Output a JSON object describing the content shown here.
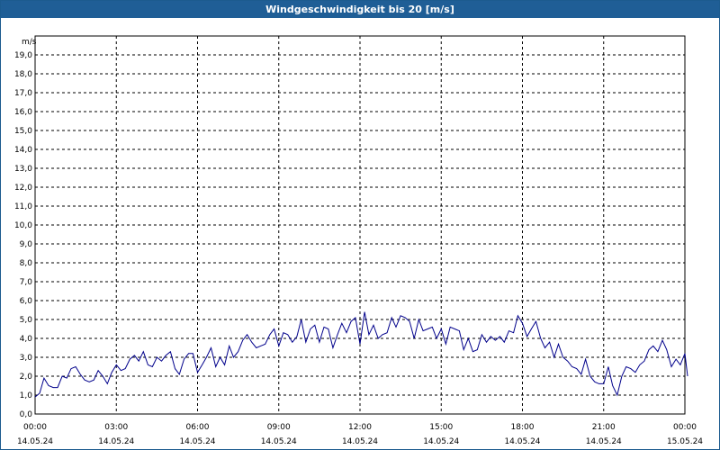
{
  "window": {
    "title": "Windgeschwindigkeit bis 20 [m/s]"
  },
  "chart_data": {
    "type": "line",
    "title": "Windgeschwindigkeit bis 20 [m/s]",
    "ylabel": "m/s",
    "xlabel": "",
    "ylim": [
      0,
      20
    ],
    "xlim": [
      0,
      24
    ],
    "grid": true,
    "line_color": "#00008b",
    "y_ticks": [
      "0,0",
      "1,0",
      "2,0",
      "3,0",
      "4,0",
      "5,0",
      "6,0",
      "7,0",
      "8,0",
      "9,0",
      "10,0",
      "11,0",
      "12,0",
      "13,0",
      "14,0",
      "15,0",
      "16,0",
      "17,0",
      "18,0",
      "19,0"
    ],
    "x_ticks": [
      {
        "time": "00:00",
        "date": "14.05.24"
      },
      {
        "time": "03:00",
        "date": "14.05.24"
      },
      {
        "time": "06:00",
        "date": "14.05.24"
      },
      {
        "time": "09:00",
        "date": "14.05.24"
      },
      {
        "time": "12:00",
        "date": "14.05.24"
      },
      {
        "time": "15:00",
        "date": "14.05.24"
      },
      {
        "time": "18:00",
        "date": "14.05.24"
      },
      {
        "time": "21:00",
        "date": "14.05.24"
      },
      {
        "time": "00:00",
        "date": "15.05.24"
      }
    ],
    "series": [
      {
        "values": [
          [
            0.0,
            0.9
          ],
          [
            0.17,
            1.1
          ],
          [
            0.33,
            1.9
          ],
          [
            0.5,
            1.5
          ],
          [
            0.67,
            1.4
          ],
          [
            0.83,
            1.4
          ],
          [
            1.0,
            2.0
          ],
          [
            1.17,
            1.9
          ],
          [
            1.33,
            2.4
          ],
          [
            1.5,
            2.5
          ],
          [
            1.67,
            2.1
          ],
          [
            1.83,
            1.8
          ],
          [
            2.0,
            1.7
          ],
          [
            2.17,
            1.8
          ],
          [
            2.33,
            2.3
          ],
          [
            2.5,
            2.0
          ],
          [
            2.67,
            1.6
          ],
          [
            2.83,
            2.2
          ],
          [
            3.0,
            2.6
          ],
          [
            3.17,
            2.3
          ],
          [
            3.33,
            2.4
          ],
          [
            3.5,
            2.9
          ],
          [
            3.67,
            3.1
          ],
          [
            3.83,
            2.8
          ],
          [
            4.0,
            3.3
          ],
          [
            4.17,
            2.6
          ],
          [
            4.33,
            2.5
          ],
          [
            4.5,
            3.0
          ],
          [
            4.67,
            2.8
          ],
          [
            4.83,
            3.1
          ],
          [
            5.0,
            3.3
          ],
          [
            5.17,
            2.4
          ],
          [
            5.33,
            2.1
          ],
          [
            5.5,
            2.9
          ],
          [
            5.67,
            3.2
          ],
          [
            5.83,
            3.2
          ],
          [
            6.0,
            2.2
          ],
          [
            6.17,
            2.6
          ],
          [
            6.33,
            3.0
          ],
          [
            6.5,
            3.5
          ],
          [
            6.67,
            2.5
          ],
          [
            6.83,
            3.0
          ],
          [
            7.0,
            2.6
          ],
          [
            7.17,
            3.6
          ],
          [
            7.33,
            3.0
          ],
          [
            7.5,
            3.3
          ],
          [
            7.67,
            3.9
          ],
          [
            7.83,
            4.2
          ],
          [
            8.0,
            3.8
          ],
          [
            8.17,
            3.5
          ],
          [
            8.33,
            3.6
          ],
          [
            8.5,
            3.7
          ],
          [
            8.67,
            4.2
          ],
          [
            8.83,
            4.5
          ],
          [
            9.0,
            3.6
          ],
          [
            9.17,
            4.3
          ],
          [
            9.33,
            4.2
          ],
          [
            9.5,
            3.8
          ],
          [
            9.67,
            4.1
          ],
          [
            9.83,
            5.0
          ],
          [
            10.0,
            3.8
          ],
          [
            10.17,
            4.5
          ],
          [
            10.33,
            4.7
          ],
          [
            10.5,
            3.8
          ],
          [
            10.67,
            4.6
          ],
          [
            10.83,
            4.5
          ],
          [
            11.0,
            3.5
          ],
          [
            11.17,
            4.2
          ],
          [
            11.33,
            4.8
          ],
          [
            11.5,
            4.3
          ],
          [
            11.67,
            4.9
          ],
          [
            11.83,
            5.1
          ],
          [
            12.0,
            3.7
          ],
          [
            12.17,
            5.4
          ],
          [
            12.33,
            4.2
          ],
          [
            12.5,
            4.7
          ],
          [
            12.67,
            4.0
          ],
          [
            12.83,
            4.2
          ],
          [
            13.0,
            4.3
          ],
          [
            13.17,
            5.1
          ],
          [
            13.33,
            4.6
          ],
          [
            13.5,
            5.2
          ],
          [
            13.67,
            5.1
          ],
          [
            13.83,
            4.9
          ],
          [
            14.0,
            4.0
          ],
          [
            14.17,
            5.0
          ],
          [
            14.33,
            4.4
          ],
          [
            14.5,
            4.5
          ],
          [
            14.67,
            4.6
          ],
          [
            14.83,
            4.0
          ],
          [
            15.0,
            4.5
          ],
          [
            15.17,
            3.7
          ],
          [
            15.33,
            4.6
          ],
          [
            15.5,
            4.5
          ],
          [
            15.67,
            4.4
          ],
          [
            15.83,
            3.4
          ],
          [
            16.0,
            4.0
          ],
          [
            16.17,
            3.3
          ],
          [
            16.33,
            3.4
          ],
          [
            16.5,
            4.2
          ],
          [
            16.67,
            3.8
          ],
          [
            16.83,
            4.1
          ],
          [
            17.0,
            3.9
          ],
          [
            17.17,
            4.1
          ],
          [
            17.33,
            3.8
          ],
          [
            17.5,
            4.4
          ],
          [
            17.67,
            4.3
          ],
          [
            17.83,
            5.2
          ],
          [
            18.0,
            4.8
          ],
          [
            18.17,
            4.1
          ],
          [
            18.33,
            4.5
          ],
          [
            18.5,
            4.9
          ],
          [
            18.67,
            4.0
          ],
          [
            18.83,
            3.5
          ],
          [
            19.0,
            3.8
          ],
          [
            19.17,
            3.0
          ],
          [
            19.33,
            3.7
          ],
          [
            19.5,
            3.0
          ],
          [
            19.67,
            2.8
          ],
          [
            19.83,
            2.5
          ],
          [
            20.0,
            2.4
          ],
          [
            20.17,
            2.1
          ],
          [
            20.33,
            2.9
          ],
          [
            20.5,
            2.0
          ],
          [
            20.67,
            1.7
          ],
          [
            20.83,
            1.6
          ],
          [
            21.0,
            1.6
          ],
          [
            21.17,
            2.5
          ],
          [
            21.33,
            1.5
          ],
          [
            21.5,
            1.0
          ],
          [
            21.67,
            2.0
          ],
          [
            21.83,
            2.5
          ],
          [
            22.0,
            2.4
          ],
          [
            22.17,
            2.2
          ],
          [
            22.33,
            2.6
          ],
          [
            22.5,
            2.8
          ],
          [
            22.67,
            3.4
          ],
          [
            22.83,
            3.6
          ],
          [
            23.0,
            3.3
          ],
          [
            23.17,
            3.9
          ],
          [
            23.33,
            3.4
          ],
          [
            23.5,
            2.5
          ],
          [
            23.67,
            2.9
          ],
          [
            23.83,
            2.6
          ],
          [
            24.0,
            3.2
          ],
          [
            24.1,
            2.0
          ]
        ]
      }
    ]
  }
}
